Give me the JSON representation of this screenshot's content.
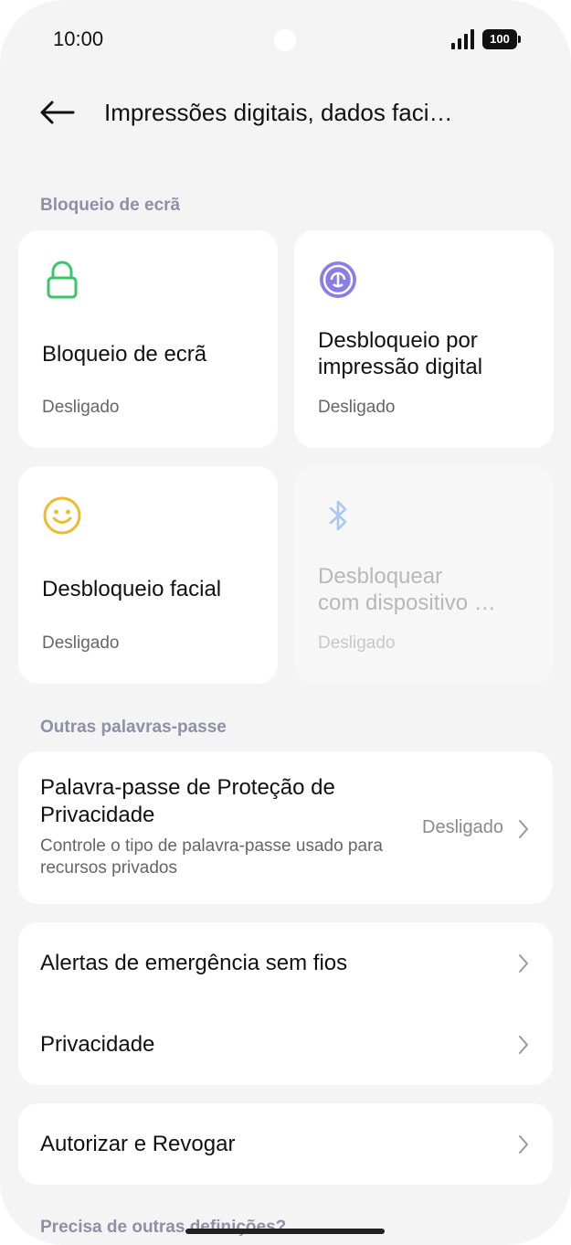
{
  "status_bar": {
    "time": "10:00",
    "battery": "100"
  },
  "header": {
    "title": "Impressões digitais, dados faci…"
  },
  "sections": {
    "lock_screen": "Bloqueio de ecrã",
    "other_passwords": "Outras palavras-passe",
    "more": "Precisa de outras definições?"
  },
  "tiles": [
    {
      "title": "Bloqueio de ecrã",
      "subtitle": "Desligado",
      "icon": "lock-icon",
      "color": "#3cc46a"
    },
    {
      "title_line1": "Desbloqueio por",
      "title_line2": "impressão digital",
      "subtitle": "Desligado",
      "icon": "fingerprint-icon",
      "color": "#8a7ee6"
    },
    {
      "title": "Desbloqueio facial",
      "subtitle": "Desligado",
      "icon": "smiley-face-icon",
      "color": "#f2b82e"
    },
    {
      "title_line1": "Desbloquear",
      "title_line2": "com dispositivo …",
      "subtitle": "Desligado",
      "icon": "bluetooth-icon",
      "color": "#a9c8f5",
      "disabled": true
    }
  ],
  "privacy_password": {
    "title": "Palavra-passe de Proteção de Privacidade",
    "description": "Controle o tipo de palavra-passe usado para recursos privados",
    "value": "Desligado"
  },
  "list_group": [
    {
      "label": "Alertas de emergência sem fios"
    },
    {
      "label": "Privacidade"
    }
  ],
  "authorize": {
    "label": "Autorizar e Revogar"
  }
}
